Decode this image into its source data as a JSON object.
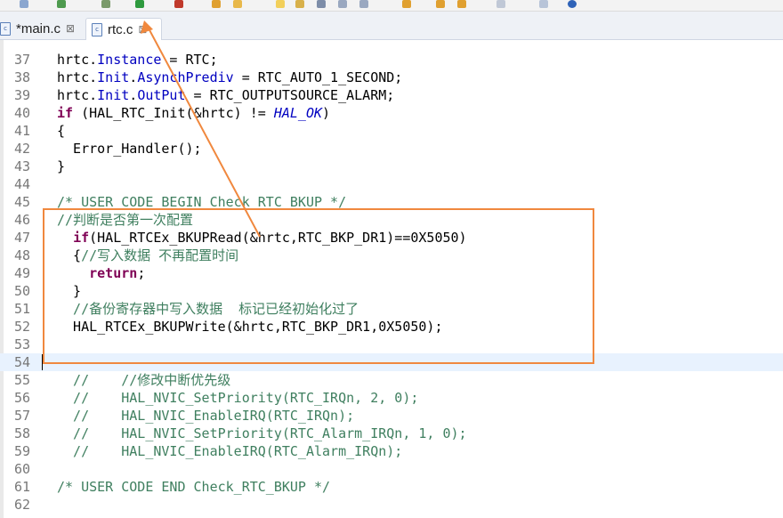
{
  "tabs": [
    {
      "label": "*main.c",
      "active": false,
      "icon": "c-file-icon"
    },
    {
      "label": "rtc.c",
      "active": true,
      "icon": "c-file-icon"
    }
  ],
  "file_icon_glyph": "c",
  "close_glyph": "⊠",
  "accent_color": "#f0883e",
  "current_line": 54,
  "lines": [
    {
      "n": "37",
      "code": "hrtc.Instance = RTC;"
    },
    {
      "n": "38",
      "code": "hrtc.Init.AsynchPrediv = RTC_AUTO_1_SECOND;"
    },
    {
      "n": "39",
      "code": "hrtc.Init.OutPut = RTC_OUTPUTSOURCE_ALARM;"
    },
    {
      "n": "40",
      "code": "if (HAL_RTC_Init(&hrtc) != HAL_OK)"
    },
    {
      "n": "41",
      "code": "{"
    },
    {
      "n": "42",
      "code": "  Error_Handler();"
    },
    {
      "n": "43",
      "code": "}"
    },
    {
      "n": "44",
      "code": ""
    },
    {
      "n": "45",
      "code": "/* USER CODE BEGIN Check_RTC_BKUP */"
    },
    {
      "n": "46",
      "code": "//判断是否第一次配置"
    },
    {
      "n": "47",
      "code": "  if(HAL_RTCEx_BKUPRead(&hrtc,RTC_BKP_DR1)==0X5050)"
    },
    {
      "n": "48",
      "code": "  {//写入数据 不再配置时间"
    },
    {
      "n": "49",
      "code": "    return;"
    },
    {
      "n": "50",
      "code": "  }"
    },
    {
      "n": "51",
      "code": "  //备份寄存器中写入数据  标记已经初始化过了"
    },
    {
      "n": "52",
      "code": "  HAL_RTCEx_BKUPWrite(&hrtc,RTC_BKP_DR1,0X5050);"
    },
    {
      "n": "53",
      "code": ""
    },
    {
      "n": "54",
      "code": ""
    },
    {
      "n": "55",
      "code": "  //    //修改中断优先级"
    },
    {
      "n": "56",
      "code": "  //    HAL_NVIC_SetPriority(RTC_IRQn, 2, 0);"
    },
    {
      "n": "57",
      "code": "  //    HAL_NVIC_EnableIRQ(RTC_IRQn);"
    },
    {
      "n": "58",
      "code": "  //    HAL_NVIC_SetPriority(RTC_Alarm_IRQn, 1, 0);"
    },
    {
      "n": "59",
      "code": "  //    HAL_NVIC_EnableIRQ(RTC_Alarm_IRQn);"
    },
    {
      "n": "60",
      "code": ""
    },
    {
      "n": "61",
      "code": "/* USER CODE END Check_RTC_BKUP */"
    },
    {
      "n": "62",
      "code": ""
    }
  ]
}
